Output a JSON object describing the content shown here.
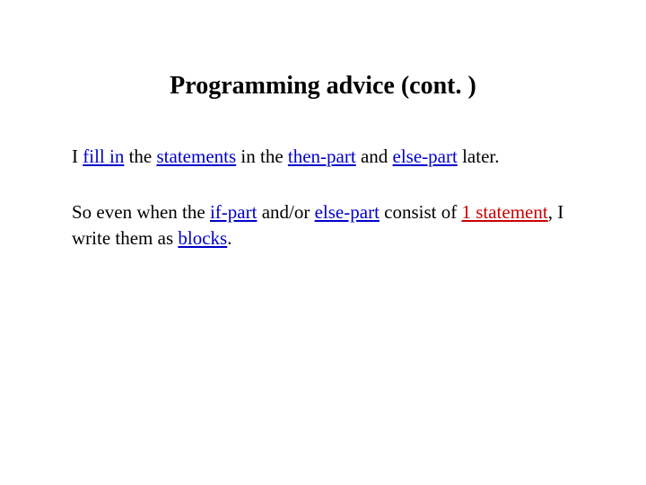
{
  "title": "Programming advice (cont. )",
  "p1": {
    "t1": "I ",
    "t2": "fill in",
    "t3": " the ",
    "t4": "statements",
    "t5": " in the ",
    "t6": "then-part",
    "t7": " and ",
    "t8": "else-part",
    "t9": " later."
  },
  "p2": {
    "t1": "So even when the ",
    "t2": "if-part",
    "t3": " and/or ",
    "t4": "else-part",
    "t5": " consist of ",
    "t6": "1 statement",
    "t7": ", I write them as ",
    "t8": "blocks",
    "t9": "."
  }
}
